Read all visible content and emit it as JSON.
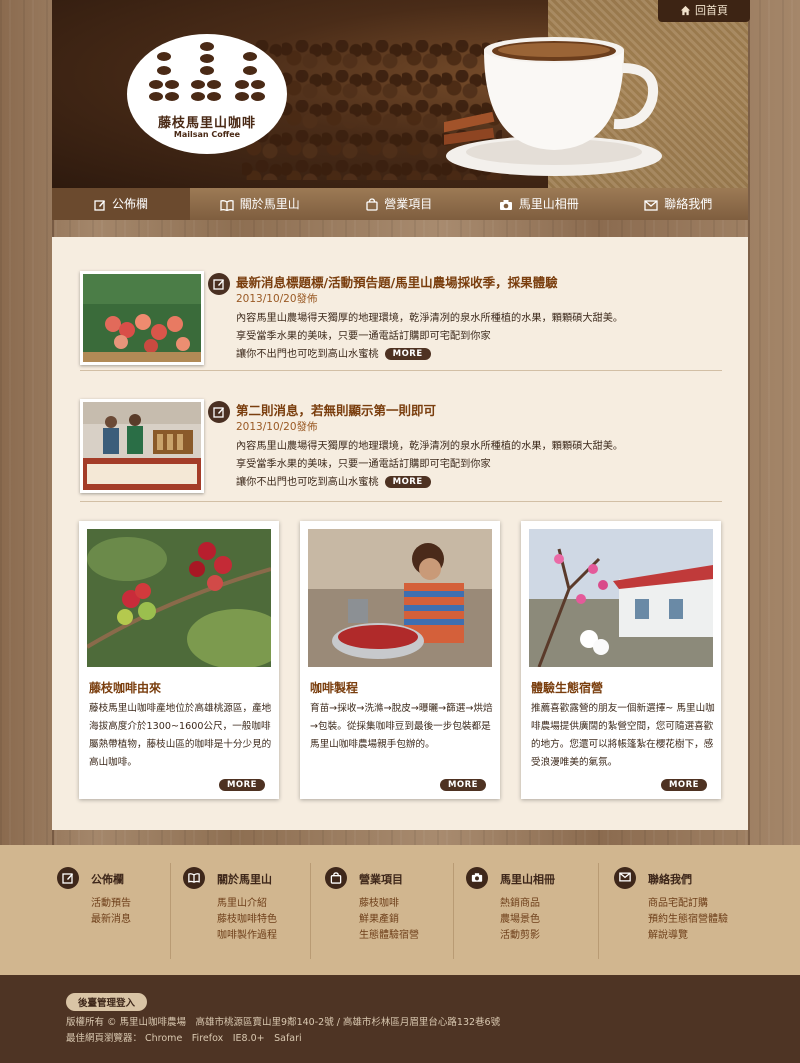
{
  "header": {
    "logo_title": "藤枝馬里山咖啡",
    "logo_subtitle": "Mailsan Coffee",
    "home_label": "回首頁"
  },
  "nav": {
    "items": [
      {
        "label": "公佈欄",
        "icon": "edit-icon"
      },
      {
        "label": "關於馬里山",
        "icon": "book-icon"
      },
      {
        "label": "營業項目",
        "icon": "bag-icon"
      },
      {
        "label": "馬里山相冊",
        "icon": "camera-icon"
      },
      {
        "label": "聯絡我們",
        "icon": "mail-icon"
      }
    ]
  },
  "news": [
    {
      "title": "最新消息標題標/活動預告題/馬里山農場採收季，採果體驗",
      "date": "2013/10/20發佈",
      "lines": [
        "內容馬里山農場得天獨厚的地理環境，乾淨清冽的泉水所種植的水果，顆顆碩大甜美。",
        "享受當季水果的美味，只要一通電話訂購即可宅配到你家",
        "讓你不出門也可吃到高山水蜜桃"
      ],
      "more": "MORE"
    },
    {
      "title": "第二則消息，若無則顯示第一則即可",
      "date": "2013/10/20發佈",
      "lines": [
        "內容馬里山農場得天獨厚的地理環境，乾淨清冽的泉水所種植的水果，顆顆碩大甜美。",
        "享受當季水果的美味，只要一通電話訂購即可宅配到你家",
        "讓你不出門也可吃到高山水蜜桃"
      ],
      "more": "MORE"
    }
  ],
  "cards": [
    {
      "title": "藤枝咖啡由來",
      "text": "藤枝馬里山咖啡產地位於高雄桃源區，產地海拔高度介於1300~1600公尺，一般咖啡屬熱帶植物，藤枝山區的咖啡是十分少見的高山咖啡。",
      "more": "MORE"
    },
    {
      "title": "咖啡製程",
      "text": "育苗→採收→洗滌→脫皮→曝曬→篩選→烘焙→包裝。從採集咖啡豆到最後一步包裝都是馬里山咖啡農場親手包辦的。",
      "more": "MORE"
    },
    {
      "title": "體驗生態宿營",
      "text": "推薦喜歡露營的朋友一個新選擇~ 馬里山咖啡農場提供廣闊的紮營空間，您可隨選喜歡的地方。您還可以將帳篷紮在櫻花樹下，感受浪漫唯美的氣氛。",
      "more": "MORE"
    }
  ],
  "footer": {
    "columns": [
      {
        "head": "公佈欄",
        "icon": "edit-icon",
        "links": [
          "活動預告",
          "最新消息"
        ]
      },
      {
        "head": "關於馬里山",
        "icon": "book-icon",
        "links": [
          "馬里山介紹",
          "藤枝咖啡特色",
          "咖啡製作過程"
        ]
      },
      {
        "head": "營業項目",
        "icon": "bag-icon",
        "links": [
          "藤枝咖啡",
          "鮮果產銷",
          "生態體驗宿營"
        ]
      },
      {
        "head": "馬里山相冊",
        "icon": "camera-icon",
        "links": [
          "熱銷商品",
          "農場景色",
          "活動剪影"
        ]
      },
      {
        "head": "聯絡我們",
        "icon": "mail-icon",
        "links": [
          "商品宅配訂購",
          "預約生態宿營體驗",
          "解說導覽"
        ]
      }
    ],
    "admin_label": "後臺管理登入",
    "copyright": "版權所有 © 馬里山咖啡農場　高雄市桃源區寶山里9鄰140-2號 / 高雄市杉林區月眉里台心路132巷6號",
    "browsers": "最佳網頁瀏覽器： Chrome　Firefox　IE8.0+　Safari"
  },
  "colors": {
    "accent": "#7a3e0e",
    "dark": "#4e3222",
    "panel": "#f6ede0"
  }
}
